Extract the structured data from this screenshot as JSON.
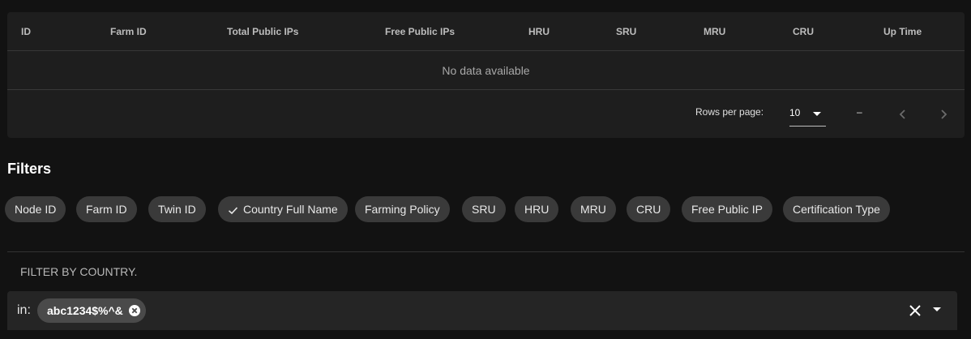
{
  "table": {
    "headers": [
      "ID",
      "Farm ID",
      "Total Public IPs",
      "Free Public IPs",
      "HRU",
      "SRU",
      "MRU",
      "CRU",
      "Up Time"
    ],
    "empty_text": "No data available",
    "footer": {
      "rows_per_page_label": "Rows per page:",
      "rows_per_page_value": "10",
      "range_text": "–",
      "prev_icon": "chevron-left-icon",
      "next_icon": "chevron-right-icon"
    }
  },
  "filters": {
    "title": "Filters",
    "chips": [
      {
        "label": "Node ID",
        "selected": false
      },
      {
        "label": "Farm ID",
        "selected": false
      },
      {
        "label": "Twin ID",
        "selected": false
      },
      {
        "label": "Country Full Name",
        "selected": true
      },
      {
        "label": "Farming Policy",
        "selected": false
      },
      {
        "label": "SRU",
        "selected": false
      },
      {
        "label": "HRU",
        "selected": false
      },
      {
        "label": "MRU",
        "selected": false
      },
      {
        "label": "CRU",
        "selected": false
      },
      {
        "label": "Free Public IP",
        "selected": false
      },
      {
        "label": "Certification Type",
        "selected": false
      }
    ]
  },
  "country_filter": {
    "caption": "FILTER BY COUNTRY.",
    "prefix": "in:",
    "values": [
      "abc1234$%^&"
    ],
    "clear_icon": "close-icon",
    "dropdown_icon": "caret-down-icon"
  },
  "colors": {
    "background": "#121212",
    "surface": "#1e1e1e",
    "chip": "#3a3a3a"
  }
}
